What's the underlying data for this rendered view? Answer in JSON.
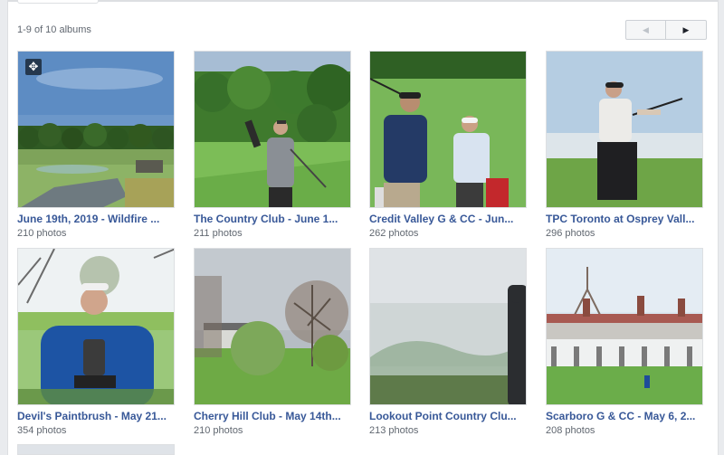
{
  "header": {
    "album_count": "1-9 of 10 albums"
  },
  "pager": {
    "prev_icon": "◀",
    "next_icon": "▶"
  },
  "albums": [
    {
      "title": "June 19th, 2019 - Wildfire ...",
      "count": "210 photos"
    },
    {
      "title": "The Country Club - June 1...",
      "count": "211 photos"
    },
    {
      "title": "Credit Valley G & CC - Jun...",
      "count": "262 photos"
    },
    {
      "title": "TPC Toronto at Osprey Vall...",
      "count": "296 photos"
    },
    {
      "title": "Devil's Paintbrush - May 21...",
      "count": "354 photos"
    },
    {
      "title": "Cherry Hill Club - May 14th...",
      "count": "210 photos"
    },
    {
      "title": "Lookout Point Country Clu...",
      "count": "213 photos"
    },
    {
      "title": "Scarboro G & CC - May 6, 2...",
      "count": "208 photos"
    }
  ],
  "colors": {
    "link": "#385898",
    "meta": "#606770",
    "border": "#dddfe2"
  }
}
